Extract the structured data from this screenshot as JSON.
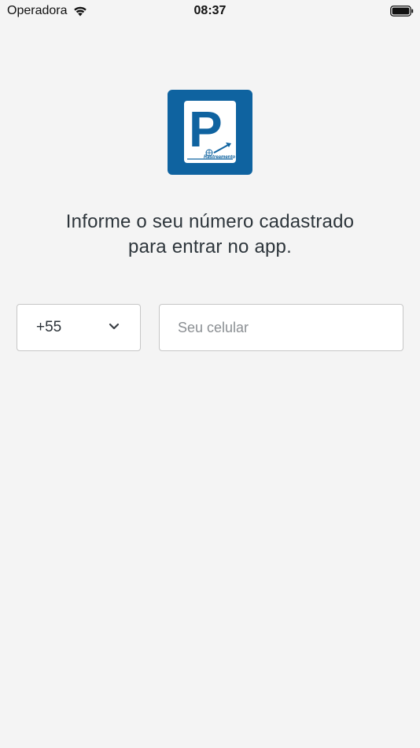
{
  "status_bar": {
    "carrier": "Operadora",
    "time": "08:37",
    "wifi_icon": "wifi-icon",
    "battery_icon": "battery-icon"
  },
  "logo": {
    "letter": "P",
    "subtext": "Rastreamento",
    "background_color": "#0f63a0"
  },
  "instruction": {
    "line1": "Informe o seu número cadastrado",
    "line2": "para entrar no app."
  },
  "country_select": {
    "value": "+55",
    "icon": "chevron-down-icon"
  },
  "phone_input": {
    "value": "",
    "placeholder": "Seu celular"
  }
}
